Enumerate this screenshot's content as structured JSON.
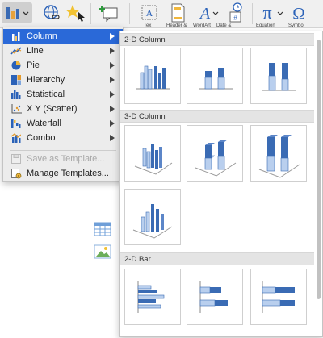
{
  "ribbon": {
    "labels": [
      "Tex",
      "Header &",
      "WordArt",
      "Date &",
      "Equation",
      "Symbol"
    ],
    "icons": [
      "chart-icon",
      "link-icon",
      "action-icon",
      "comment-icon",
      "textbox-icon",
      "header-footer-icon",
      "wordart-icon",
      "date-time-icon",
      "equation-icon",
      "symbol-icon"
    ]
  },
  "menu": {
    "items": [
      {
        "label": "Column",
        "icon": "column-chart-icon",
        "submenu": true,
        "selected": true
      },
      {
        "label": "Line",
        "icon": "line-chart-icon",
        "submenu": true
      },
      {
        "label": "Pie",
        "icon": "pie-chart-icon",
        "submenu": true
      },
      {
        "label": "Hierarchy",
        "icon": "hierarchy-chart-icon",
        "submenu": true
      },
      {
        "label": "Statistical",
        "icon": "statistical-chart-icon",
        "submenu": true
      },
      {
        "label": "X Y (Scatter)",
        "icon": "scatter-chart-icon",
        "submenu": true
      },
      {
        "label": "Waterfall",
        "icon": "waterfall-chart-icon",
        "submenu": true
      },
      {
        "label": "Combo",
        "icon": "combo-chart-icon",
        "submenu": true
      },
      {
        "label": "Save as Template...",
        "icon": "save-template-icon",
        "disabled": true
      },
      {
        "label": "Manage Templates...",
        "icon": "manage-templates-icon"
      }
    ]
  },
  "gallery": {
    "sections": [
      {
        "title": "2-D Column",
        "tiles": [
          "Clustered Column",
          "Stacked Column",
          "100% Stacked Column"
        ]
      },
      {
        "title": "3-D Column",
        "tiles": [
          "3-D Clustered Column",
          "3-D Stacked Column",
          "3-D 100% Stacked Column",
          "3-D Column"
        ]
      },
      {
        "title": "2-D Bar",
        "tiles": [
          "Clustered Bar",
          "Stacked Bar",
          "100% Stacked Bar"
        ]
      }
    ]
  },
  "colors": {
    "selection": "#2a69d8",
    "chart_dark": "#3a6bb4",
    "chart_light": "#b9cfee"
  }
}
